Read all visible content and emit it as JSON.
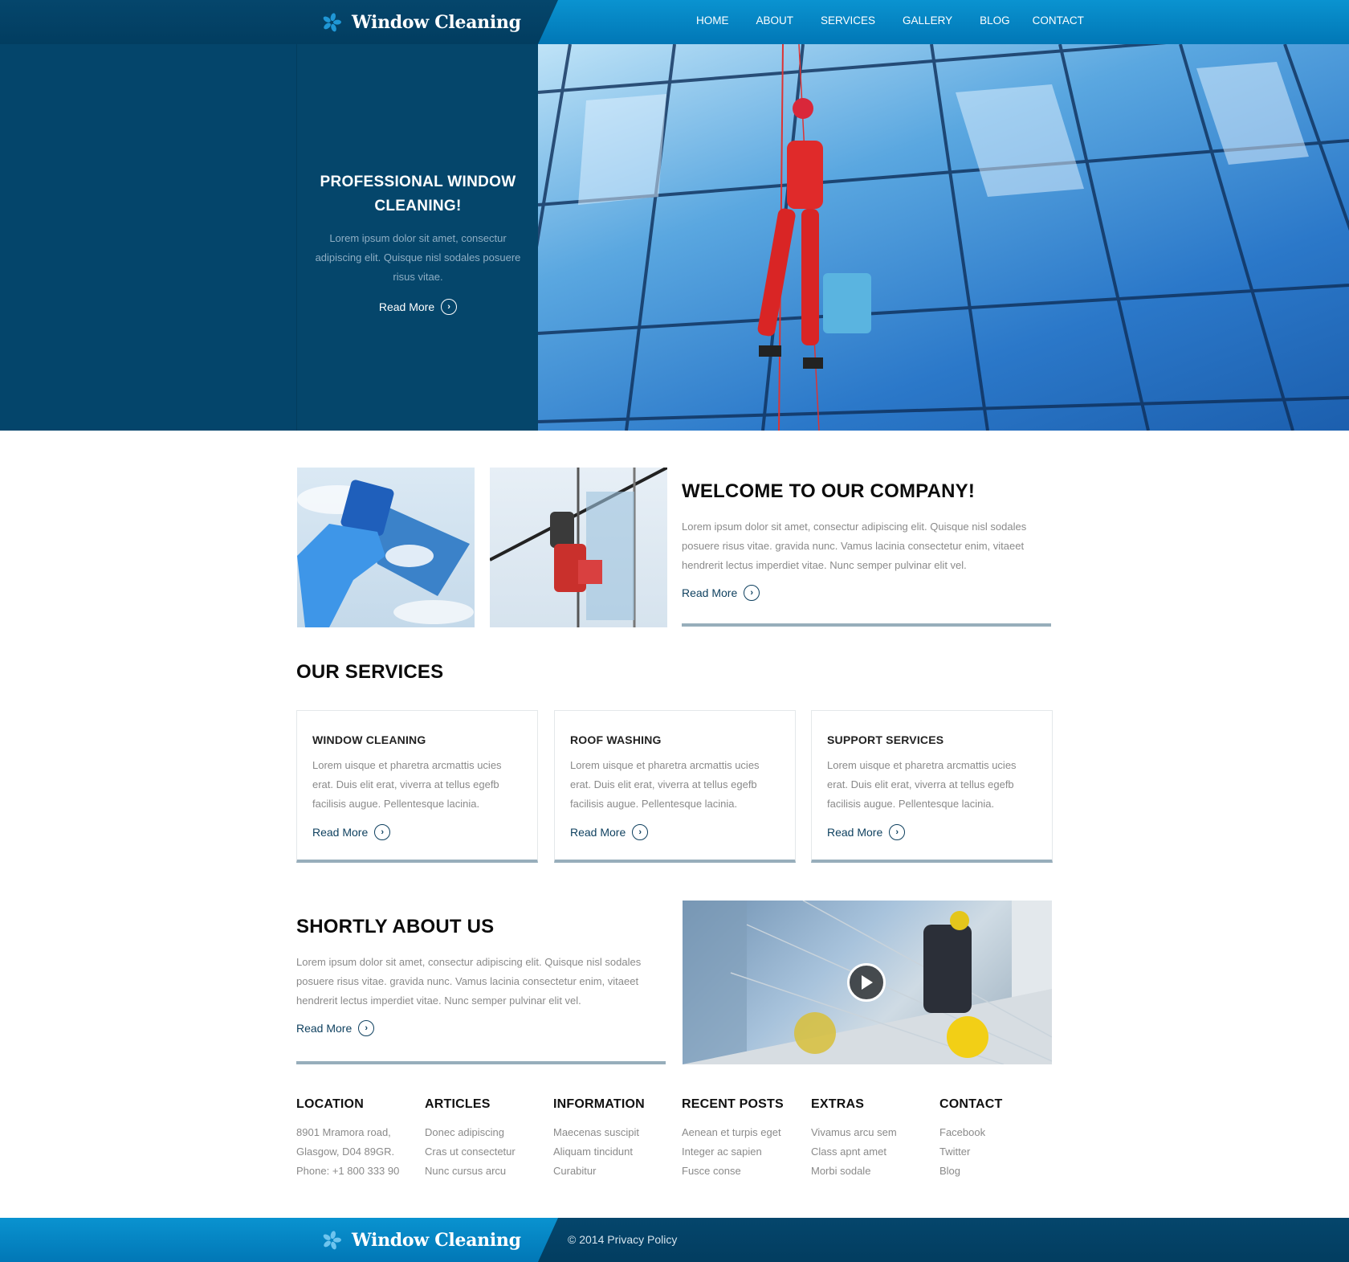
{
  "brand": {
    "name": "Window Cleaning",
    "icon": "pinwheel-icon",
    "colors": {
      "primary_blue": "#0a93d0",
      "dark_navy": "#04456b",
      "accent_bar": "#97aebb",
      "link_color": "#0d3f5e"
    }
  },
  "nav": {
    "items": [
      {
        "label": "HOME"
      },
      {
        "label": "ABOUT"
      },
      {
        "label": "SERVICES"
      },
      {
        "label": "GALLERY"
      },
      {
        "label": "BLOG"
      },
      {
        "label": "CONTACT"
      }
    ]
  },
  "hero": {
    "title": "PROFESSIONAL WINDOW CLEANING!",
    "text": "Lorem ipsum dolor sit amet, consectur adipiscing elit. Quisque  nisl sodales posuere risus vitae.",
    "read_more": "Read More",
    "image": "window-washer-on-glass-facade-photo"
  },
  "welcome": {
    "title": "WELCOME TO OUR COMPANY!",
    "text": "Lorem ipsum dolor sit amet, consectur adipiscing elit. Quisque  nisl sodales posuere risus vitae.   gravida nunc. Vamus lacinia consectetur enim, vitaeet hendrerit lectus imperdiet vitae. Nunc semper pulvinar elit vel.",
    "read_more": "Read More",
    "images": [
      "glove-sponge-sky-photo",
      "climber-cleaning-window-photo"
    ]
  },
  "services": {
    "title": "OUR SERVICES",
    "items": [
      {
        "title": "WINDOW CLEANING",
        "text": "Lorem uisque et pharetra arcmattis ucies erat. Duis elit erat, viverra at tellus egefb facilisis augue. Pellentesque lacinia.",
        "read_more": "Read More"
      },
      {
        "title": "ROOF WASHING",
        "text": "Lorem uisque et pharetra arcmattis ucies erat. Duis elit erat, viverra at tellus egefb facilisis augue. Pellentesque lacinia.",
        "read_more": "Read More"
      },
      {
        "title": "SUPPORT SERVICES",
        "text": "Lorem uisque et pharetra arcmattis ucies erat. Duis elit erat, viverra at tellus egefb facilisis augue. Pellentesque lacinia.",
        "read_more": "Read More"
      }
    ]
  },
  "about": {
    "title": "SHORTLY ABOUT US",
    "text": "Lorem ipsum dolor sit amet, consectur adipiscing elit. Quisque  nisl sodales posuere risus vitae.   gravida nunc. Vamus lacinia consectetur enim, vitaeet hendrerit lectus imperdiet vitae. Nunc semper pulvinar elit vel.",
    "read_more": "Read More",
    "video": "window-cleaner-video-thumbnail"
  },
  "footer_columns": [
    {
      "title": "LOCATION",
      "lines": [
        "8901 Mramora road,",
        "Glasgow, D04 89GR.",
        "Phone: +1 800 333 90"
      ]
    },
    {
      "title": "ARTICLES",
      "lines": [
        "Donec adipiscing",
        "Cras ut consectetur",
        "Nunc cursus arcu"
      ]
    },
    {
      "title": "INFORMATION",
      "lines": [
        "Maecenas suscipit",
        "Aliquam tincidunt",
        "Curabitur"
      ]
    },
    {
      "title": "RECENT POSTS",
      "lines": [
        "Aenean et turpis eget",
        "Integer ac sapien",
        "Fusce conse"
      ]
    },
    {
      "title": "EXTRAS",
      "lines": [
        "Vivamus arcu sem",
        "Class apnt  amet",
        "Morbi sodale"
      ]
    },
    {
      "title": "CONTACT",
      "lines": [
        "Facebook",
        "Twitter",
        "Blog"
      ]
    }
  ],
  "bottom_bar": {
    "copyright": "© 2014 Privacy Policy"
  }
}
